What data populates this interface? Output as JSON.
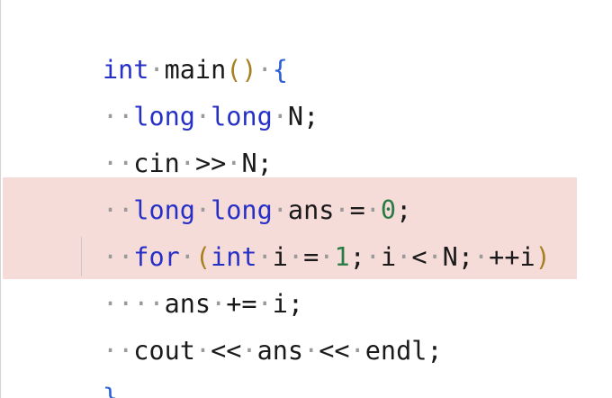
{
  "editor": {
    "language": "cpp",
    "highlight_color": "#f6dcd9",
    "whitespace_marker": "·",
    "lines": [
      {
        "text": "int main() {"
      },
      {
        "text": "  long long N;"
      },
      {
        "text": "  cin >> N;"
      },
      {
        "text": "  long long ans = 0;"
      },
      {
        "text": "  for (int i = 1; i < N; ++i)",
        "highlighted": true
      },
      {
        "text": "    ans += i;",
        "highlighted": true
      },
      {
        "text": "  cout << ans << endl;"
      },
      {
        "text": "}"
      }
    ]
  }
}
